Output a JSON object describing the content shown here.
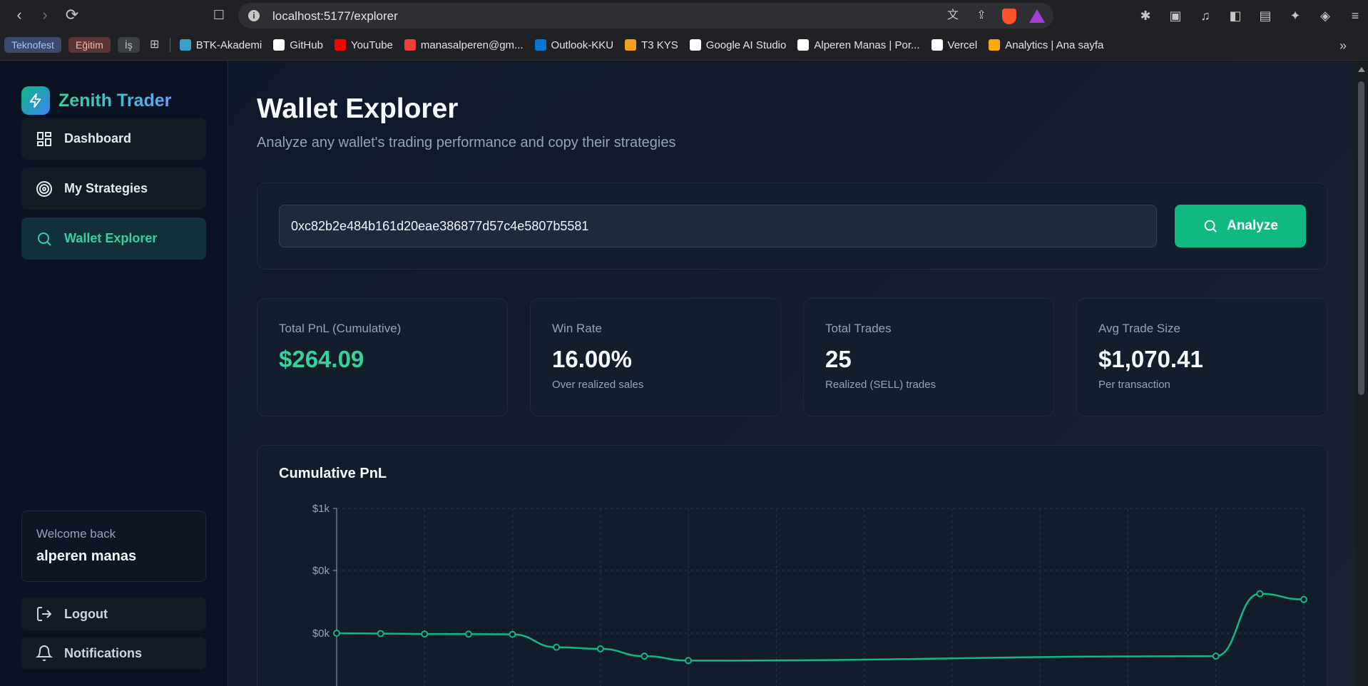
{
  "browser": {
    "url": "localhost:5177/explorer",
    "bookmarks": [
      {
        "label": "Teknofest",
        "style": "blue"
      },
      {
        "label": "Eğitim",
        "style": "red"
      },
      {
        "label": "İş",
        "style": "gray"
      }
    ],
    "links": [
      {
        "label": "BTK-Akademi",
        "color": "#3aa0c8"
      },
      {
        "label": "GitHub",
        "color": "#ffffff"
      },
      {
        "label": "YouTube",
        "color": "#ff0000"
      },
      {
        "label": "manasalperen@gm...",
        "color": "#ea4335"
      },
      {
        "label": "Outlook-KKU",
        "color": "#0078d4"
      },
      {
        "label": "T3 KYS",
        "color": "#f4a21d"
      },
      {
        "label": "Google AI Studio",
        "color": "#ffffff"
      },
      {
        "label": "Alperen Manas | Por...",
        "color": "#ffffff"
      },
      {
        "label": "Vercel",
        "color": "#ffffff"
      },
      {
        "label": "Analytics | Ana sayfa",
        "color": "#f9ab00"
      }
    ],
    "more": "»"
  },
  "sidebar": {
    "brand": "Zenith Trader",
    "nav": [
      {
        "label": "Dashboard",
        "icon": "dashboard-icon"
      },
      {
        "label": "My Strategies",
        "icon": "target-icon"
      },
      {
        "label": "Wallet Explorer",
        "icon": "search-icon",
        "active": true
      }
    ],
    "welcome_label": "Welcome back",
    "user_name": "alperen manas",
    "logout": "Logout",
    "notifications": "Notifications"
  },
  "main": {
    "title": "Wallet Explorer",
    "subtitle": "Analyze any wallet's trading performance and copy their strategies",
    "address_value": "0xc82b2e484b161d20eae386877d57c4e5807b5581",
    "analyze_label": "Analyze",
    "stats": [
      {
        "label": "Total PnL (Cumulative)",
        "value": "$264.09",
        "sub": "",
        "accent": "#34d399"
      },
      {
        "label": "Win Rate",
        "value": "16.00%",
        "sub": "Over realized sales"
      },
      {
        "label": "Total Trades",
        "value": "25",
        "sub": "Realized (SELL) trades"
      },
      {
        "label": "Avg Trade Size",
        "value": "$1,070.41",
        "sub": "Per transaction"
      }
    ]
  },
  "chart_data": {
    "type": "line",
    "title": "Cumulative PnL",
    "y_tick_labels": [
      "$1k",
      "$0k",
      "$0k"
    ],
    "series": [
      {
        "color": "#10b981",
        "values": [
          0,
          -5,
          -12,
          -14,
          -18,
          -220,
          -245,
          -360,
          -430,
          null,
          null,
          null,
          null,
          null,
          null,
          null,
          null,
          null,
          null,
          null,
          -360,
          620,
          530
        ]
      }
    ],
    "x_grid_lines": 11
  },
  "colors": {
    "accent": "#10b981",
    "background": "#0f172a",
    "sidebar": "#0b1221"
  }
}
